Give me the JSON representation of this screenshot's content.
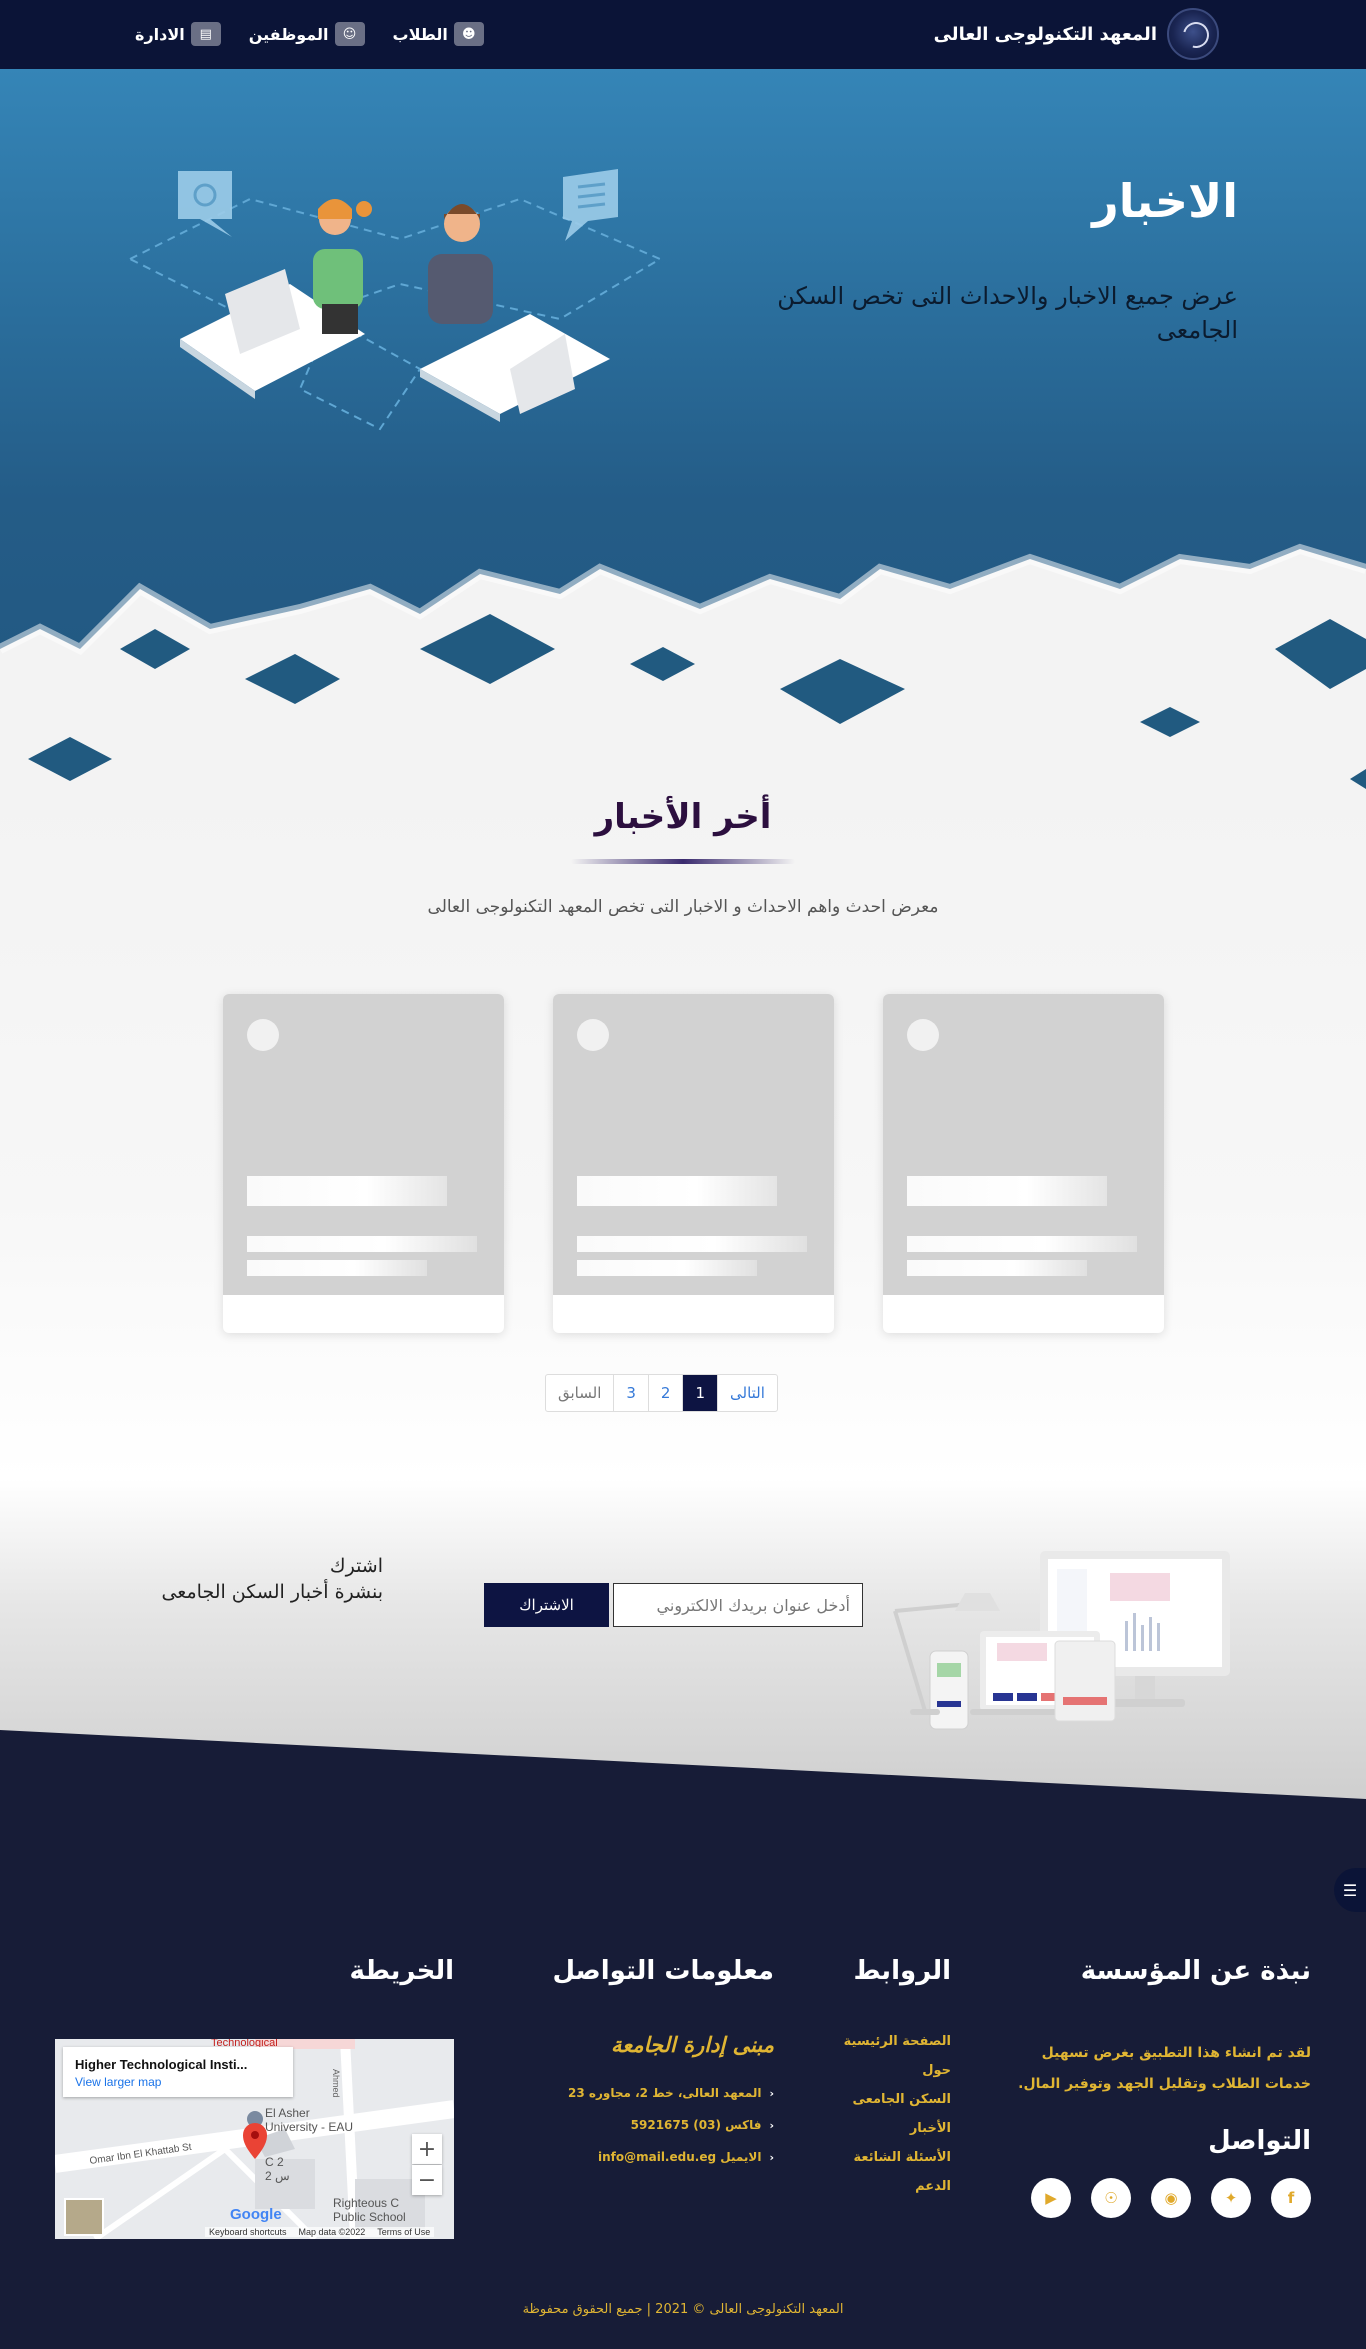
{
  "navbar": {
    "brand_name": "المعهد التكنولوجى العالى",
    "links": [
      {
        "label": "الطلاب",
        "icon": "user-icon"
      },
      {
        "label": "الموظفين",
        "icon": "users-icon"
      },
      {
        "label": "الادارة",
        "icon": "newspaper-icon"
      }
    ]
  },
  "hero": {
    "title": "الاخبار",
    "subtitle": "عرض جميع الاخبار والاحداث التى تخص السكن الجامعى"
  },
  "news": {
    "title": "أخر الأخبار",
    "description": "معرض احدث واهم الاحداث و الاخبار التى تخص المعهد التكنولوجى العالى",
    "pagination": {
      "prev": "السابق",
      "pages": [
        "3",
        "2",
        "1"
      ],
      "active": "1",
      "next": "التالى"
    }
  },
  "newsletter": {
    "label_line1": "اشترك",
    "label_line2": "بنشرة أخبار السكن الجامعى",
    "input_placeholder": "أدخل عنوان بريدك الالكتروني",
    "button_label": "الاشتراك"
  },
  "footer": {
    "about": {
      "title": "نبذة عن المؤسسة",
      "text": "لقد تم انشاء هذا التطبيق بغرض تسهيل خدمات الطلاب وتقليل الجهد وتوفير المال."
    },
    "social": {
      "title": "التواصل",
      "items": [
        "facebook-icon",
        "twitter-icon",
        "instagram-icon",
        "github-icon",
        "youtube-icon"
      ]
    },
    "links": {
      "title": "الروابط",
      "items": [
        "الصفحة الرئيسية",
        "حول",
        "السكن الجامعى",
        "الأخبار",
        "الأسئلة الشائعة",
        "الدعم"
      ]
    },
    "contact": {
      "title": "معلومات التواصل",
      "subtitle": "مبنى إدارة الجامعة",
      "items": [
        "المعهد العالى، خط 2، مجاوره 23",
        "فاكس (03) 5921675",
        "الايميل info@mail.edu.eg"
      ]
    },
    "map": {
      "title": "الخريطة",
      "place_name": "Higher Technological Insti...",
      "larger_map": "View larger map",
      "labels": [
        "El Asher",
        "University - EAU",
        "Omar Ibn El Khattab St",
        "C 2",
        "س 2",
        "Righteous C",
        "Public School",
        "Technological",
        "Ahmed"
      ],
      "footer_items": [
        "Keyboard shortcuts",
        "Map data ©2022",
        "Terms of Use"
      ],
      "google": "Google"
    },
    "copyright": "المعهد التكنولوجى العالى © 2021 | جميع الحقوق محفوظة"
  },
  "colors": {
    "navy": "#0b1437",
    "hero_blue": "#2a6d9b",
    "accent_gold": "#e0b533",
    "footer_bg": "#171c37"
  }
}
